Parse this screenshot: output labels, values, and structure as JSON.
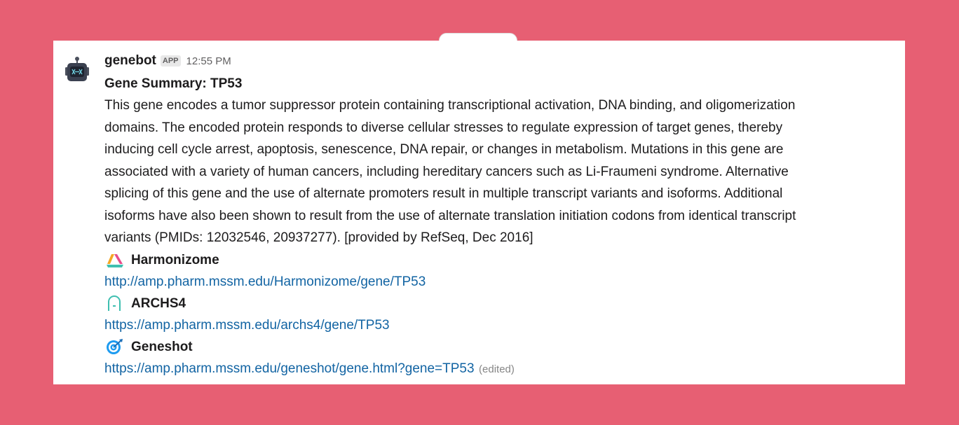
{
  "message": {
    "sender": "genebot",
    "badge": "APP",
    "time": "12:55 PM",
    "title": "Gene Summary: TP53",
    "body_lines": [
      "This gene encodes a tumor suppressor protein containing transcriptional activation, DNA binding, and oligomerization",
      "domains. The encoded protein responds to diverse cellular stresses to regulate expression of target genes, thereby",
      "inducing cell cycle arrest, apoptosis, senescence, DNA repair, or changes in metabolism. Mutations in this gene are",
      "associated with a variety of human cancers, including hereditary cancers such as Li-Fraumeni syndrome. Alternative",
      "splicing of this gene and the use of alternate promoters result in multiple transcript variants and isoforms. Additional",
      "isoforms have also been shown to result from the use of alternate translation initiation codons from identical transcript",
      "variants (PMIDs: 12032546, 20937277). [provided by RefSeq, Dec 2016]"
    ],
    "resources": [
      {
        "name": "Harmonizome",
        "icon": "harmonizome-icon",
        "url": "http://amp.pharm.mssm.edu/Harmonizome/gene/TP53"
      },
      {
        "name": "ARCHS4",
        "icon": "archs4-icon",
        "url": "https://amp.pharm.mssm.edu/archs4/gene/TP53"
      },
      {
        "name": "Geneshot",
        "icon": "geneshot-icon",
        "url": "https://amp.pharm.mssm.edu/geneshot/gene.html?gene=TP53"
      }
    ],
    "edited_label": "(edited)"
  },
  "colors": {
    "page_background": "#e75f73",
    "card_background": "#ffffff",
    "link": "#1264a3",
    "text": "#1d1c1d",
    "muted": "#616061"
  }
}
